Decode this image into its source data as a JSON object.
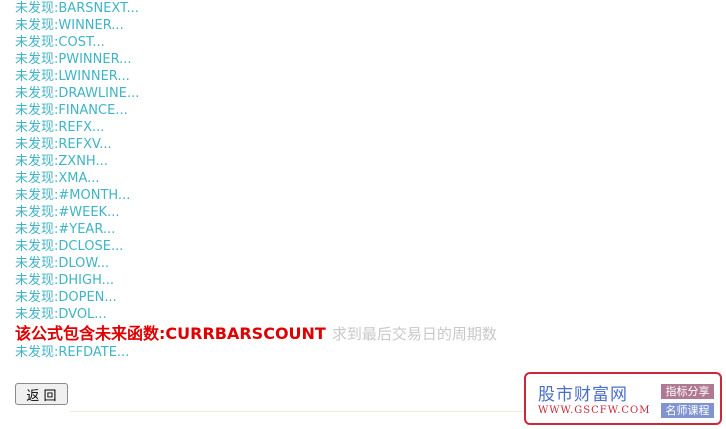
{
  "items_before": [
    "未发现:BARSNEXT...",
    "未发现:WINNER...",
    "未发现:COST...",
    "未发现:PWINNER...",
    "未发现:LWINNER...",
    "未发现:DRAWLINE...",
    "未发现:FINANCE...",
    "未发现:REFX...",
    "未发现:REFXV...",
    "未发现:ZXNH...",
    "未发现:XMA...",
    "未发现:#MONTH...",
    "未发现:#WEEK...",
    "未发现:#YEAR...",
    "未发现:DCLOSE...",
    "未发现:DLOW...",
    "未发现:DHIGH...",
    "未发现:DOPEN...",
    "未发现:DVOL..."
  ],
  "warning": {
    "text": "该公式包含未来函数:CURRBARSCOUNT",
    "description": "求到最后交易日的周期数"
  },
  "item_after": "未发现:REFDATE...",
  "back_button": "返 回",
  "logo": {
    "name_cn": "股市财富网",
    "url": "WWW.GSCFW.COM",
    "tag1": "指标分享",
    "tag2": "名师课程"
  },
  "colors": {
    "item_text": "#3fb4c6",
    "warning_text": "#e00000",
    "description_text": "#c8c8c8",
    "logo_border": "#c82a3a",
    "logo_text": "#4b6fc9"
  }
}
